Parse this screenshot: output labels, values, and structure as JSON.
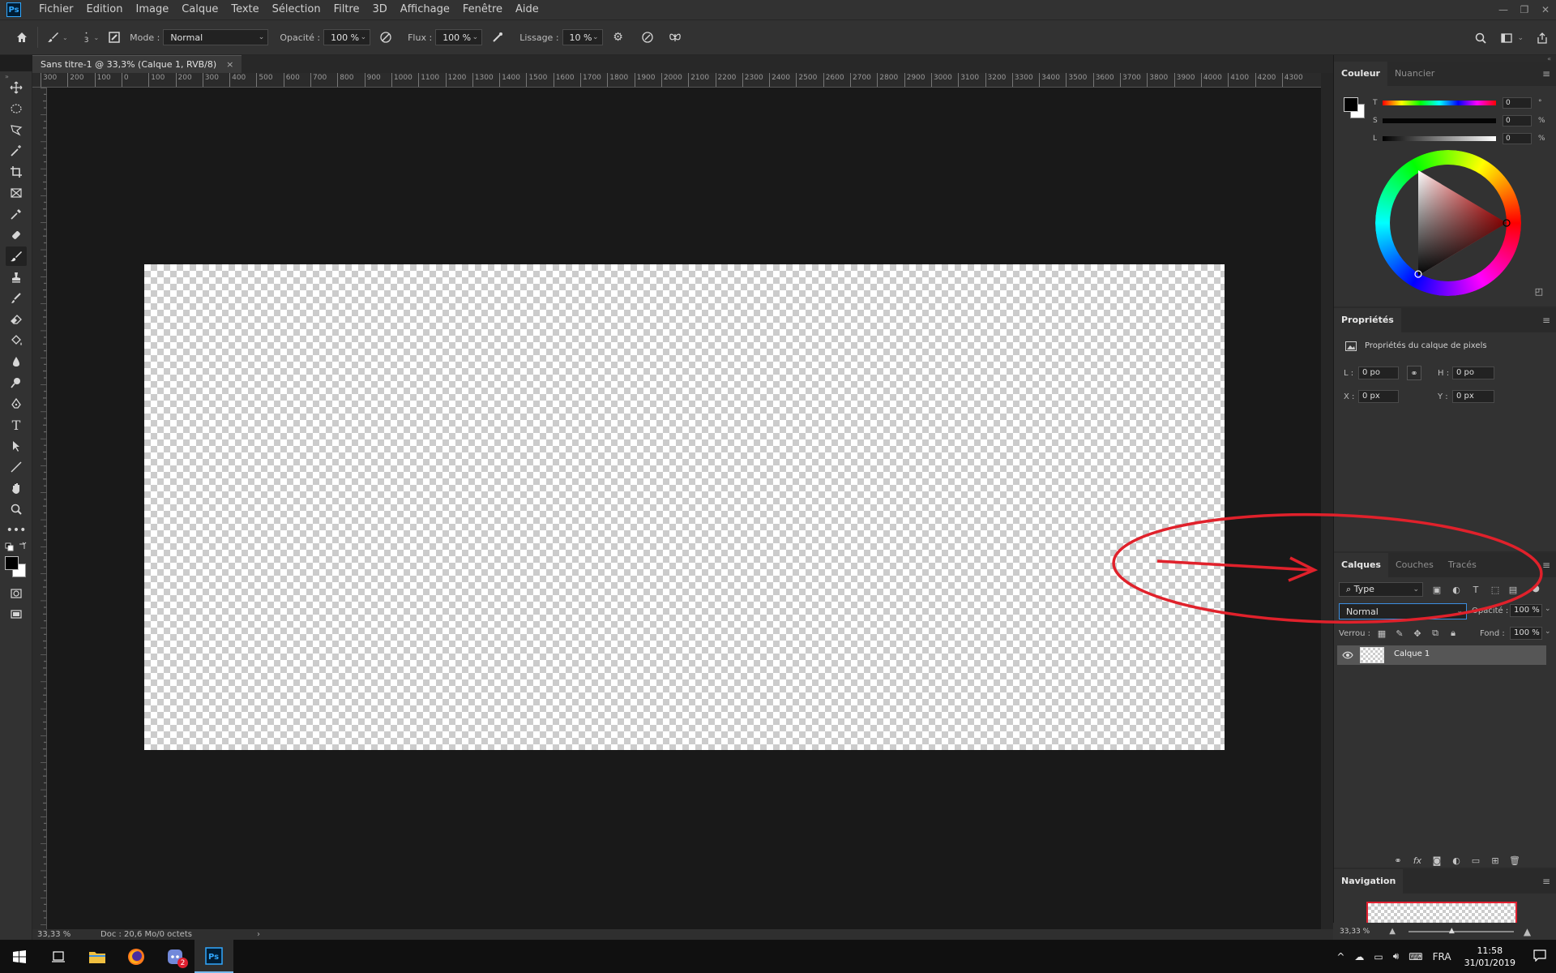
{
  "app": {
    "logo": "Ps"
  },
  "menu": [
    "Fichier",
    "Edition",
    "Image",
    "Calque",
    "Texte",
    "Sélection",
    "Filtre",
    "3D",
    "Affichage",
    "Fenêtre",
    "Aide"
  ],
  "options": {
    "brush_size": "3",
    "mode_label": "Mode :",
    "mode_value": "Normal",
    "opacity_label": "Opacité :",
    "opacity_value": "100 %",
    "flow_label": "Flux :",
    "flow_value": "100 %",
    "smoothing_label": "Lissage :",
    "smoothing_value": "10 %"
  },
  "document": {
    "tab_title": "Sans titre-1 @ 33,3% (Calque 1, RVB/8)",
    "close": "×"
  },
  "ruler": {
    "top": [
      "300",
      "200",
      "100",
      "0",
      "100",
      "200",
      "300",
      "400",
      "500",
      "600",
      "700",
      "800",
      "900",
      "1000",
      "1100",
      "1200",
      "1300",
      "1400",
      "1500",
      "1600",
      "1700",
      "1800",
      "1900",
      "2000",
      "2100",
      "2200",
      "2300",
      "2400",
      "2500",
      "2600",
      "2700",
      "2800",
      "2900",
      "3000",
      "3100",
      "3200",
      "3300",
      "3400",
      "3500",
      "3600",
      "3700",
      "3800",
      "3900",
      "4000",
      "4100",
      "4200",
      "4300"
    ]
  },
  "status": {
    "zoom": "33,33 %",
    "doc": "Doc : 20,6 Mo/0 octets",
    "arrow": "›"
  },
  "color_panel": {
    "tabs": [
      "Couleur",
      "Nuancier"
    ],
    "sliders": [
      {
        "label": "T",
        "value": "0",
        "unit": "°"
      },
      {
        "label": "S",
        "value": "0",
        "unit": "%"
      },
      {
        "label": "L",
        "value": "0",
        "unit": "%"
      }
    ]
  },
  "properties_panel": {
    "tab": "Propriétés",
    "subtitle": "Propriétés du calque de pixels",
    "w_label": "L :",
    "w_value": "0 po",
    "h_label": "H :",
    "h_value": "0 po",
    "x_label": "X :",
    "x_value": "0 px",
    "y_label": "Y :",
    "y_value": "0 px"
  },
  "layers_panel": {
    "tabs": [
      "Calques",
      "Couches",
      "Tracés"
    ],
    "filter_value": "Type",
    "blend_mode": "Normal",
    "opacity_label": "Opacité :",
    "opacity_value": "100 %",
    "lock_label": "Verrou :",
    "fill_label": "Fond :",
    "fill_value": "100 %",
    "layers": [
      {
        "name": "Calque 1",
        "visible": true
      }
    ],
    "footer_icons": [
      "link-icon",
      "fx-icon",
      "mask-icon",
      "adjustment-icon",
      "folder-icon",
      "new-layer-icon",
      "trash-icon"
    ],
    "fx_text": "fx"
  },
  "navigation_panel": {
    "tab": "Navigation",
    "zoom": "33,33 %"
  },
  "taskbar": {
    "apps": [
      "start",
      "task-view",
      "file-explorer",
      "firefox",
      "discord",
      "photoshop"
    ],
    "discord_badge": "2",
    "lang": "FRA",
    "time": "11:58",
    "date": "31/01/2019"
  },
  "colors": {
    "annotation": "#e0212b",
    "accent": "#31a8ff",
    "nav_frame": "#e02030"
  }
}
